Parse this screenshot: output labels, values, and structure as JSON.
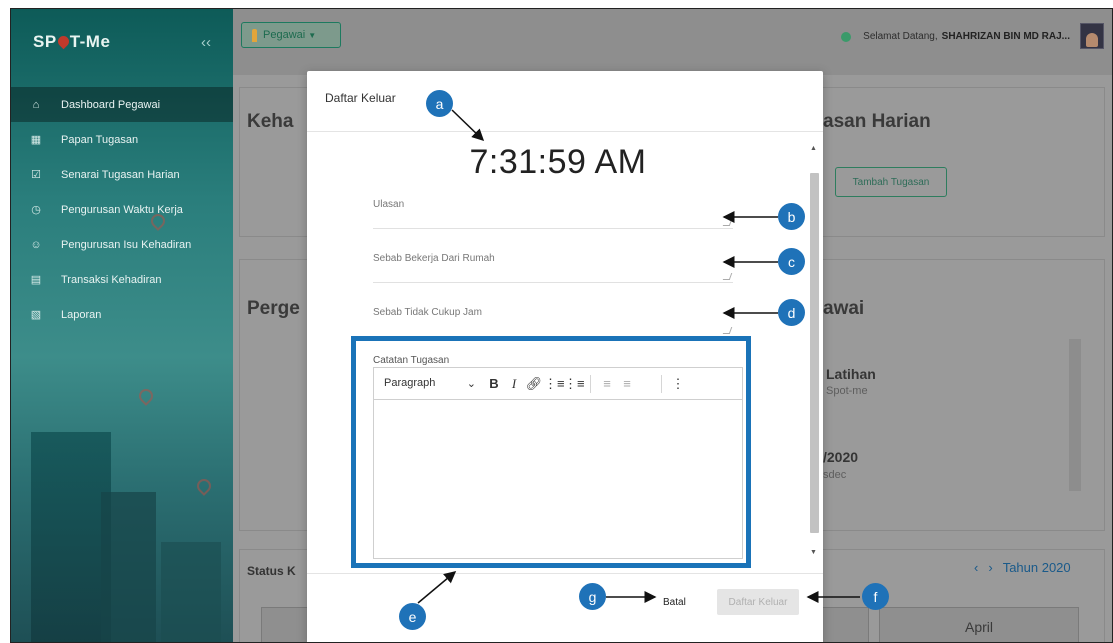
{
  "app": {
    "logo_text": "SPOT-Me",
    "collapse_icon": "double-chevron-left-icon"
  },
  "sidebar": {
    "items": [
      {
        "label": "Dashboard Pegawai",
        "icon": "home-icon",
        "active": true
      },
      {
        "label": "Papan Tugasan",
        "icon": "board-icon",
        "active": false
      },
      {
        "label": "Senarai Tugasan Harian",
        "icon": "checklist-icon",
        "active": false
      },
      {
        "label": "Pengurusan Waktu Kerja",
        "icon": "clock-icon",
        "active": false
      },
      {
        "label": "Pengurusan Isu Kehadiran",
        "icon": "user-icon",
        "active": false
      },
      {
        "label": "Transaksi Kehadiran",
        "icon": "list-icon",
        "active": false
      },
      {
        "label": "Laporan",
        "icon": "report-icon",
        "active": false
      }
    ]
  },
  "topbar": {
    "role_button": "Pegawai",
    "welcome_text": "Selamat Datang,",
    "user_name": "SHAHRIZAN BIN MD RAJ..."
  },
  "background": {
    "card1_title": "Keha",
    "card2_title": "asan Harian",
    "add_task_button": "Tambah Tugasan",
    "card3_title": "Perge",
    "card4_title": "awai",
    "item1_title": "Latihan",
    "item1_sub": "Spot-me",
    "item2_title": "/2020",
    "item2_sub": "sdec",
    "status_label": "Status K",
    "year_label": "Tahun 2020",
    "month_april": "April"
  },
  "modal": {
    "title": "Daftar Keluar",
    "clock": "7:31:59 AM",
    "fields": {
      "ulasan_placeholder": "Ulasan",
      "wfh_placeholder": "Sebab Bekerja Dari Rumah",
      "insufficient_placeholder": "Sebab Tidak Cukup Jam"
    },
    "notes_label": "Catatan Tugasan",
    "editor": {
      "format_select": "Paragraph",
      "tools": [
        "bold-icon",
        "italic-icon",
        "link-icon",
        "bullet-list-icon",
        "numbered-list-icon",
        "outdent-icon",
        "indent-icon",
        "more-icon"
      ]
    },
    "cancel_label": "Batal",
    "submit_label": "Daftar Keluar"
  },
  "annotations": {
    "highlight_color": "#1f72b8",
    "labels": [
      "a",
      "b",
      "c",
      "d",
      "e",
      "f",
      "g"
    ]
  }
}
